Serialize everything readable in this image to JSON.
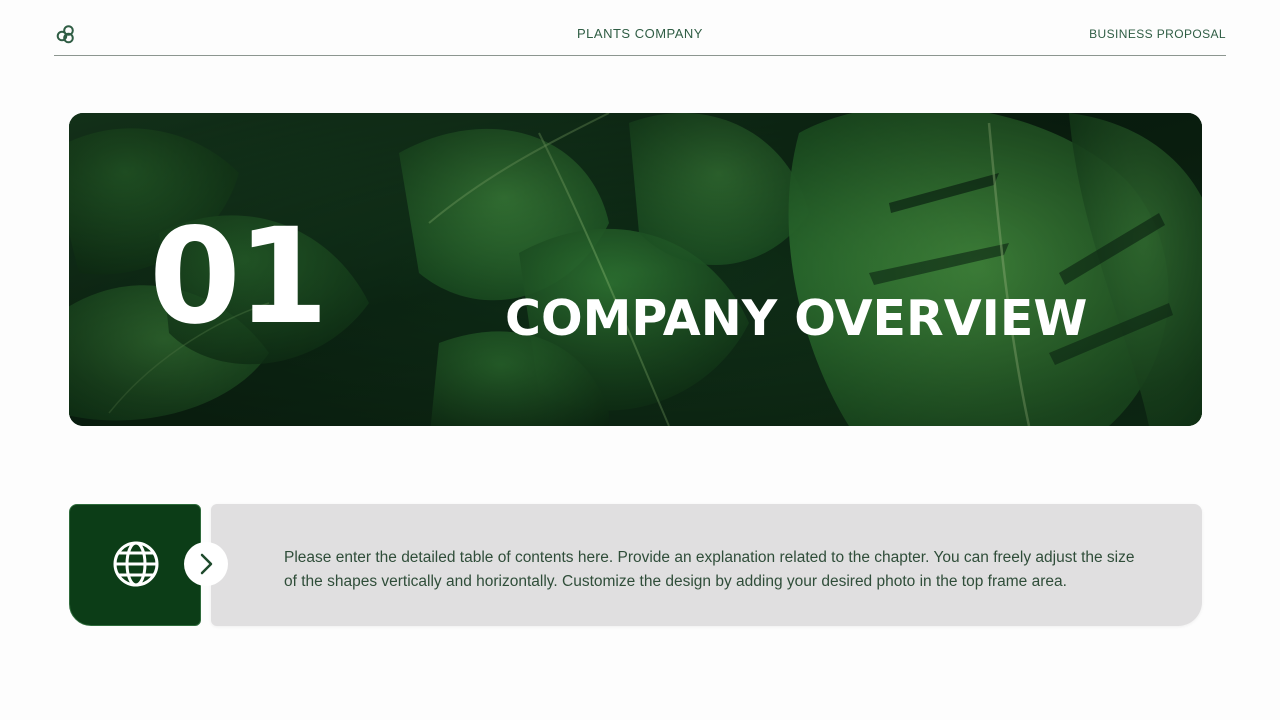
{
  "header": {
    "company": "PLANTS COMPANY",
    "document_type": "BUSINESS PROPOSAL",
    "logo_icon": "logo-icon"
  },
  "hero": {
    "chapter_number": "01",
    "chapter_title": "COMPANY OVERVIEW"
  },
  "section": {
    "icon": "globe-icon",
    "next_icon": "chevron-right-icon",
    "description": "Please enter the detailed table of contents here. Provide an explanation related to the chapter. You can freely adjust the size of the shapes vertically and horizontally. Customize the design by adding your desired photo in the top frame area."
  },
  "colors": {
    "brand_green": "#0c3d17",
    "text_green": "#2f5d44",
    "panel_gray": "#e0dfe0",
    "white": "#ffffff"
  }
}
